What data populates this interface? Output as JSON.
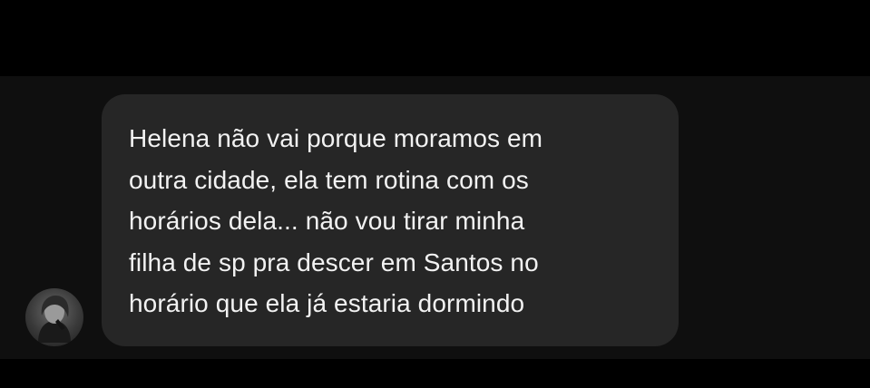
{
  "conversation": {
    "sender_avatar_icon": "user-avatar-photo",
    "message": {
      "text": "Helena não vai porque moramos em\noutra cidade, ela tem rotina com os\nhorários dela... não vou tirar minha\nfilha de sp pra descer em Santos no\nhorário que ela já estaria dormindo"
    }
  },
  "colors": {
    "background": "#000000",
    "chat_area": "#0f0f0f",
    "bubble": "#262626",
    "text": "#f2f2f2"
  }
}
